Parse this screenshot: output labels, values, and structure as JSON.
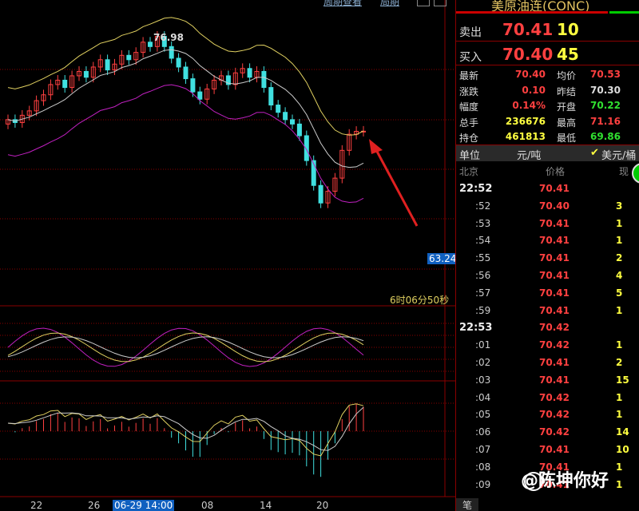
{
  "colors": {
    "up": "#ff4040",
    "down": "#40e0e0",
    "grid": "#8a0000",
    "ma_white": "#cccccc",
    "ma_yellow": "#e0d060",
    "ma_magenta": "#c020c0",
    "price_up": "#ff4040",
    "price_down": "#30e030",
    "volume": "#ffff40"
  },
  "top_links": [
    "周期查看",
    "局期"
  ],
  "product_title": "美原油连(CONC)",
  "price_chart": {
    "high_label": "76.98",
    "axis_price_label": "63.24",
    "countdown": "6时06分50秒",
    "x_ticks": [
      "22",
      "26",
      "06-29 14:00",
      "08",
      "14",
      "20"
    ],
    "annotation": "red-arrow"
  },
  "chart_data": {
    "type": "candlestick",
    "note_high": 76.98,
    "axis_price_marker": 63.24,
    "approx_close_series": [
      71.2,
      71.0,
      71.5,
      71.8,
      72.5,
      72.9,
      73.6,
      73.9,
      73.4,
      74.2,
      74.5,
      74.1,
      74.8,
      75.3,
      74.6,
      75.0,
      75.6,
      75.3,
      75.8,
      76.5,
      76.2,
      76.9,
      76.2,
      75.4,
      74.8,
      74.0,
      73.1,
      72.6,
      73.3,
      73.9,
      74.2,
      73.6,
      74.4,
      74.7,
      74.1,
      74.5,
      73.4,
      72.2,
      71.7,
      71.2,
      70.9,
      70.1,
      68.4,
      66.7,
      65.5,
      66.3,
      67.2,
      69.1,
      70.2,
      70.4,
      70.41
    ]
  },
  "quote": {
    "ask": {
      "label": "卖出",
      "price": "70.41",
      "volume": "10"
    },
    "bid": {
      "label": "买入",
      "price": "70.40",
      "volume": "45"
    }
  },
  "stats": [
    {
      "l1": "最新",
      "v1": "70.40",
      "c1": "red",
      "l2": "均价",
      "v2": "70.53",
      "c2": "red"
    },
    {
      "l1": "涨跌",
      "v1": "0.10",
      "c1": "red",
      "l2": "昨结",
      "v2": "70.30",
      "c2": "white"
    },
    {
      "l1": "幅度",
      "v1": "0.14%",
      "c1": "red",
      "l2": "开盘",
      "v2": "70.22",
      "c2": "green"
    },
    {
      "l1": "总手",
      "v1": "236676",
      "c1": "yellow",
      "l2": "最高",
      "v2": "71.16",
      "c2": "red"
    },
    {
      "l1": "持仓",
      "v1": "461813",
      "c1": "yellow",
      "l2": "最低",
      "v2": "69.86",
      "c2": "green"
    }
  ],
  "unit_bar": {
    "label": "单位",
    "unit": "元/吨",
    "check": "✔",
    "currency": "美元/桶"
  },
  "tick_header": {
    "time": "北京",
    "price": "价格",
    "volume": "现"
  },
  "ticks": [
    {
      "time": "22:52",
      "major": true,
      "price": "70.41",
      "vol": "",
      "dir": "red"
    },
    {
      "time": ":52",
      "major": false,
      "price": "70.40",
      "vol": "3",
      "dir": "red"
    },
    {
      "time": ":53",
      "major": false,
      "price": "70.41",
      "vol": "1",
      "dir": "red"
    },
    {
      "time": ":54",
      "major": false,
      "price": "70.41",
      "vol": "1",
      "dir": "red"
    },
    {
      "time": ":55",
      "major": false,
      "price": "70.41",
      "vol": "2",
      "dir": "red"
    },
    {
      "time": ":56",
      "major": false,
      "price": "70.41",
      "vol": "4",
      "dir": "red"
    },
    {
      "time": ":57",
      "major": false,
      "price": "70.41",
      "vol": "5",
      "dir": "red"
    },
    {
      "time": ":59",
      "major": false,
      "price": "70.41",
      "vol": "1",
      "dir": "red"
    },
    {
      "time": "22:53",
      "major": true,
      "price": "70.42",
      "vol": "",
      "dir": "red"
    },
    {
      "time": ":01",
      "major": false,
      "price": "70.42",
      "vol": "1",
      "dir": "red"
    },
    {
      "time": ":02",
      "major": false,
      "price": "70.41",
      "vol": "2",
      "dir": "red"
    },
    {
      "time": ":03",
      "major": false,
      "price": "70.41",
      "vol": "15",
      "dir": "red"
    },
    {
      "time": ":04",
      "major": false,
      "price": "70.42",
      "vol": "1",
      "dir": "red"
    },
    {
      "time": ":05",
      "major": false,
      "price": "70.42",
      "vol": "1",
      "dir": "red"
    },
    {
      "time": ":06",
      "major": false,
      "price": "70.42",
      "vol": "14",
      "dir": "red"
    },
    {
      "time": ":07",
      "major": false,
      "price": "70.41",
      "vol": "10",
      "dir": "red"
    },
    {
      "time": ":08",
      "major": false,
      "price": "70.41",
      "vol": "1",
      "dir": "red"
    },
    {
      "time": ":09",
      "major": false,
      "price": "70.41",
      "vol": "1",
      "dir": "red"
    }
  ],
  "bottom_tab": "笔",
  "watermark": "@陈坤你好"
}
